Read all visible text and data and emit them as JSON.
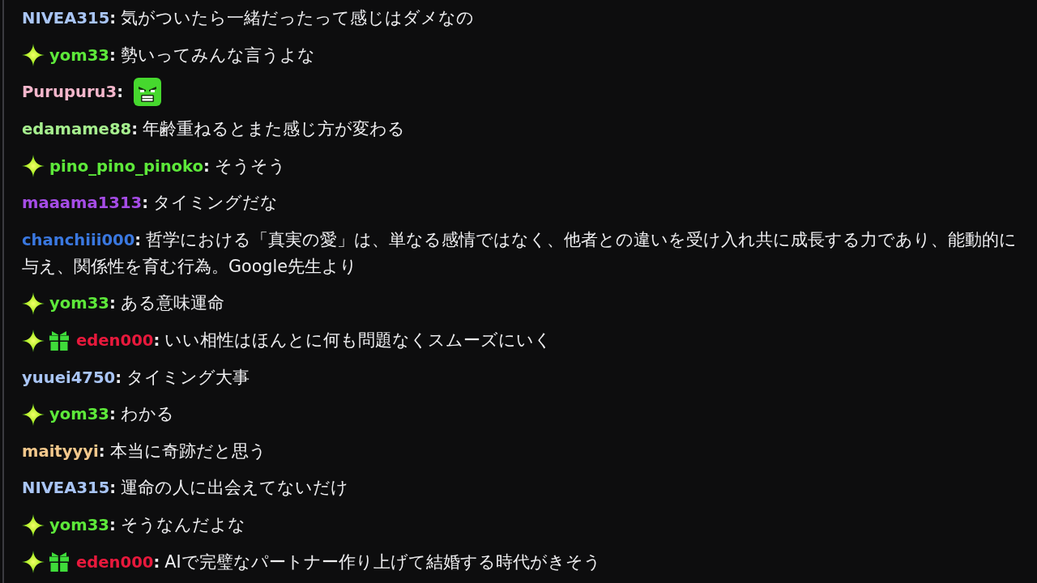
{
  "chat": {
    "messages": [
      {
        "kind": "text",
        "user": "NIVEA315",
        "color": "#a9c5f5",
        "separator": ":",
        "lines": [
          "気がついたら一緒だったって感じはダメなの"
        ]
      },
      {
        "kind": "text",
        "badges": [
          {
            "kind": "sparkle"
          }
        ],
        "user": "yom33",
        "color": "#5de83a",
        "separator": ":",
        "lines": [
          "勢いってみんな言うよな"
        ]
      },
      {
        "kind": "emote",
        "user": "Purupuru3",
        "color": "#f3b6cb",
        "separator": ":"
      },
      {
        "kind": "text",
        "user": "edamame88",
        "color": "#a6ef8e",
        "separator": ":",
        "lines": [
          "年齢重ねるとまた感じ方が変わる"
        ]
      },
      {
        "kind": "text",
        "badges": [
          {
            "kind": "sparkle"
          }
        ],
        "user": "pino_pino_pinoko",
        "color": "#5de83a",
        "separator": ":",
        "lines": [
          "そうそう"
        ]
      },
      {
        "kind": "text",
        "user": "maaama1313",
        "color": "#a54ce6",
        "separator": ":",
        "lines": [
          "タイミングだな"
        ]
      },
      {
        "kind": "text",
        "user": "chanchiii000",
        "color": "#3a78e0",
        "separator": ":",
        "lines": [
          "哲学における「真実の愛」は、単なる感情ではなく、他者との違いを受け入れ共に成長する力であり、能動的に",
          "与え、関係性を育む行為。Google先生より"
        ]
      },
      {
        "kind": "text",
        "badges": [
          {
            "kind": "sparkle"
          }
        ],
        "user": "yom33",
        "color": "#5de83a",
        "separator": ":",
        "lines": [
          "ある意味運命"
        ]
      },
      {
        "kind": "text",
        "badges": [
          {
            "kind": "sparkle"
          },
          {
            "kind": "gift"
          }
        ],
        "user": "eden000",
        "color": "#e8193c",
        "separator": ":",
        "lines": [
          "いい相性はほんとに何も問題なくスムーズにいく"
        ]
      },
      {
        "kind": "text",
        "user": "yuuei4750",
        "color": "#a9c5f5",
        "separator": ":",
        "lines": [
          "タイミング大事"
        ]
      },
      {
        "kind": "text",
        "badges": [
          {
            "kind": "sparkle"
          }
        ],
        "user": "yom33",
        "color": "#5de83a",
        "separator": ":",
        "lines": [
          "わかる"
        ]
      },
      {
        "kind": "text",
        "user": "maityyyi",
        "color": "#f3c88c",
        "separator": ":",
        "lines": [
          "本当に奇跡だと思う"
        ]
      },
      {
        "kind": "text",
        "user": "NIVEA315",
        "color": "#a9c5f5",
        "separator": ":",
        "lines": [
          "運命の人に出会えてないだけ"
        ]
      },
      {
        "kind": "text",
        "badges": [
          {
            "kind": "sparkle"
          }
        ],
        "user": "yom33",
        "color": "#5de83a",
        "separator": ":",
        "lines": [
          "そうなんだよな"
        ]
      },
      {
        "kind": "text",
        "badges": [
          {
            "kind": "sparkle"
          },
          {
            "kind": "gift"
          }
        ],
        "user": "eden000",
        "color": "#e8193c",
        "separator": ":",
        "lines": [
          "AIで完璧なパートナー作り上げて結婚する時代がきそう"
        ]
      }
    ]
  }
}
